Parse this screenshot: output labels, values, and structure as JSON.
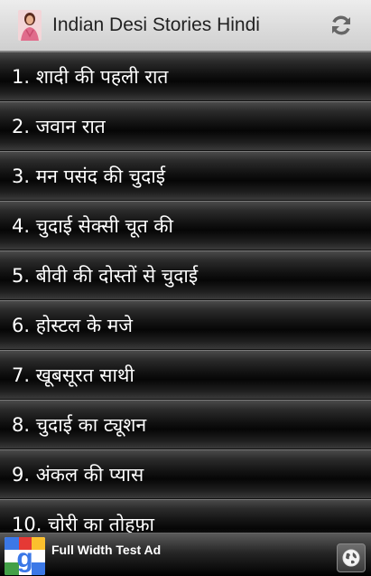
{
  "app": {
    "title": "Indian Desi Stories Hindi",
    "icon": "woman-avatar-icon",
    "refresh_icon": "refresh-icon"
  },
  "stories": [
    {
      "label": "1. शादी की पहली रात"
    },
    {
      "label": "2. जवान रात"
    },
    {
      "label": "3. मन पसंद की चुदाई"
    },
    {
      "label": "4. चुदाई सेक्सी चूत की"
    },
    {
      "label": "5. बीवी की दोस्तों से चुदाई"
    },
    {
      "label": "6. होस्टल के मजे"
    },
    {
      "label": "7. खूबसूरत साथी"
    },
    {
      "label": "8. चुदाई का ट्यूशन"
    },
    {
      "label": "9. अंकल की प्यास"
    },
    {
      "label": "10. चोरी का तोहफ़ा"
    }
  ],
  "ad": {
    "text": "Full Width Test Ad",
    "logo": "google-logo-icon",
    "globe": "globe-icon"
  },
  "colors": {
    "appbar": "#dadada",
    "row_text": "#ffffff",
    "list_bg": "#000000"
  }
}
